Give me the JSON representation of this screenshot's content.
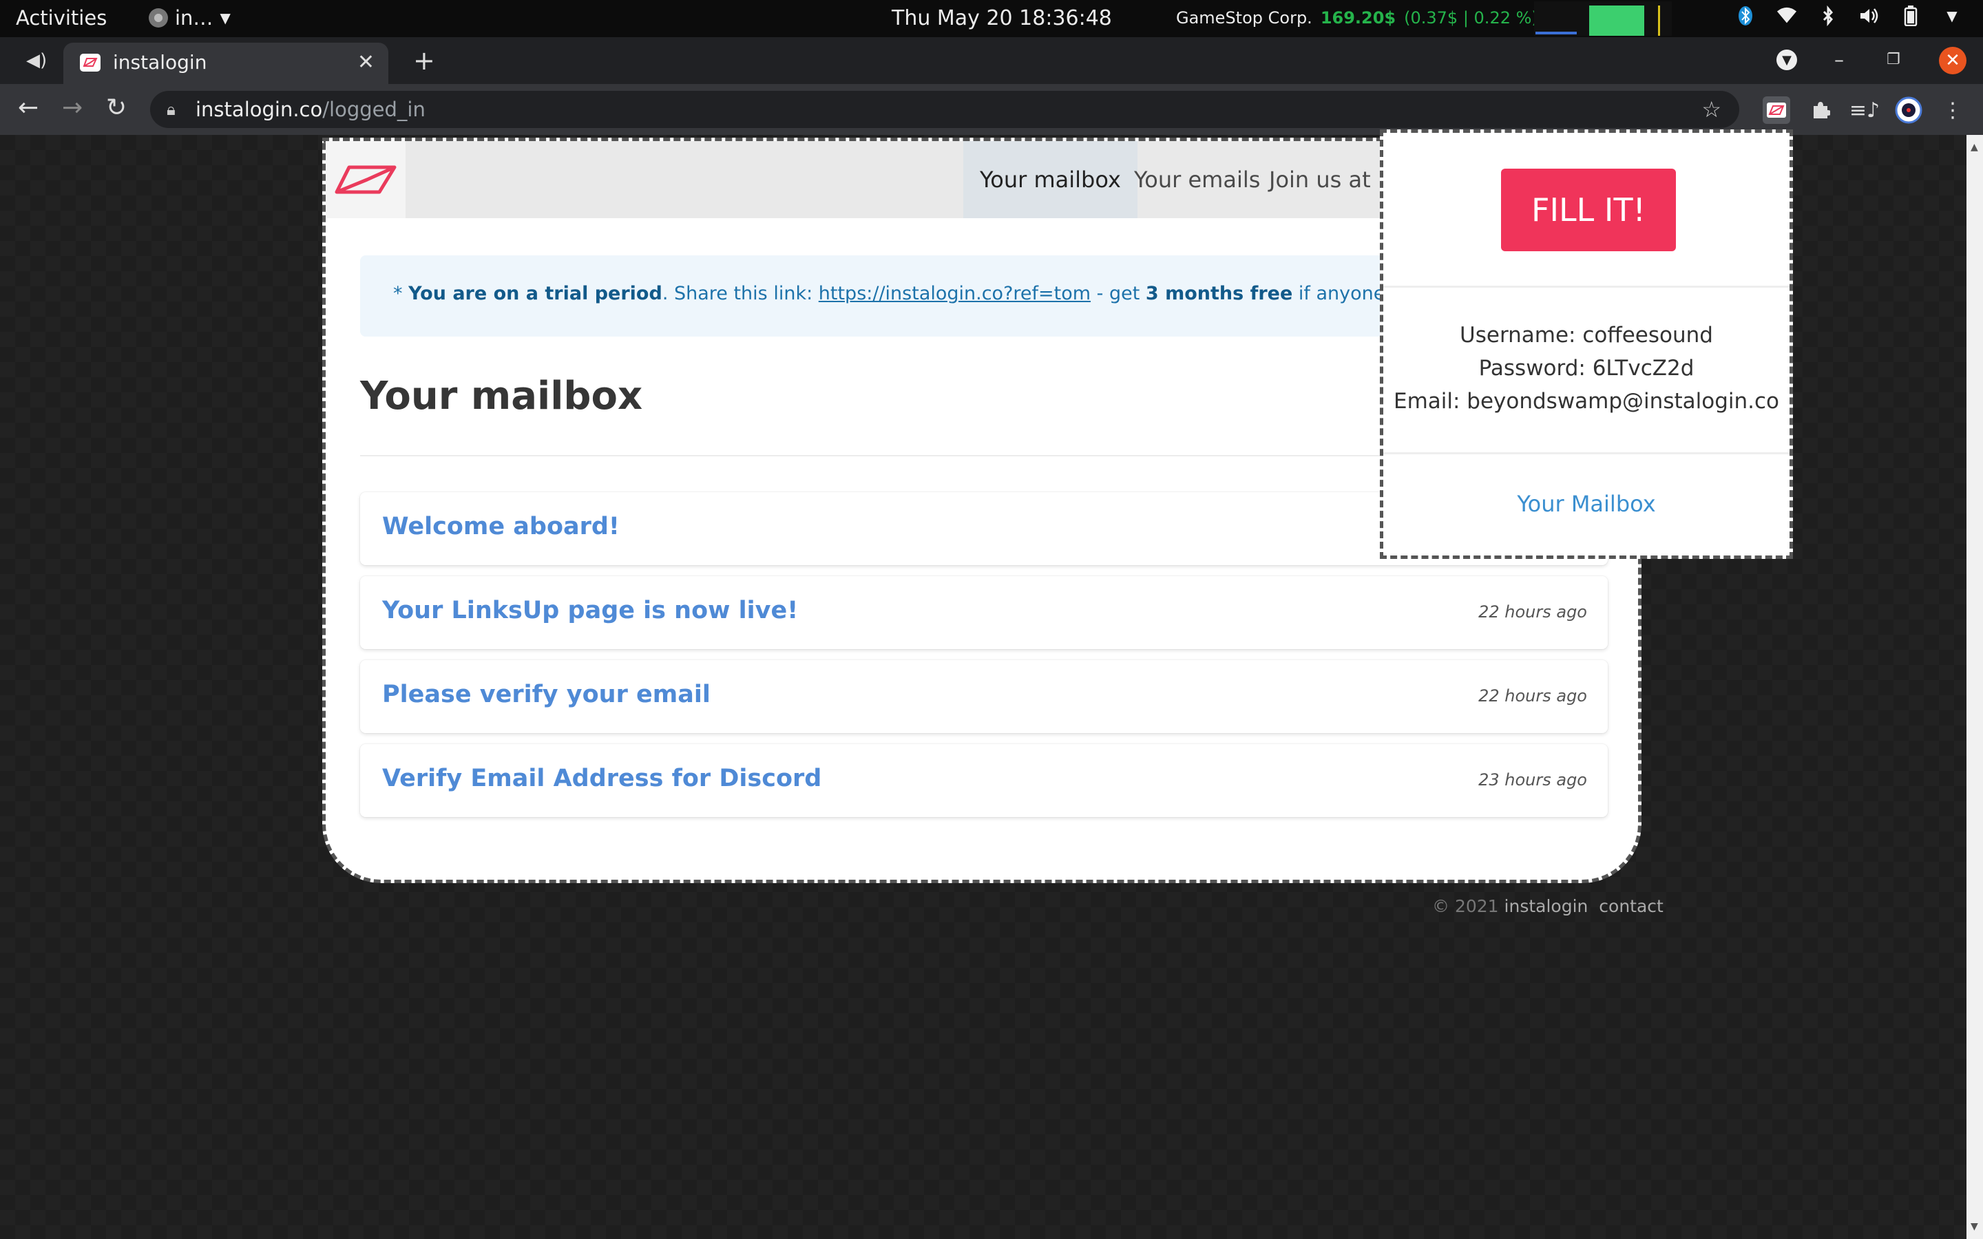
{
  "system": {
    "activities": "Activities",
    "app_menu": "in…",
    "clock": "Thu May 20  18:36:48",
    "stock_name": "GameStop Corp.",
    "stock_price": "169.20$",
    "stock_change": "(0.37$ | 0.22 %)"
  },
  "browser": {
    "tab_title": "instalogin",
    "url_domain": "instalogin.co",
    "url_path": "/logged_in"
  },
  "site": {
    "nav": [
      "Your mailbox",
      "Your emails",
      "Join us at"
    ],
    "notice": {
      "prefix": "* ",
      "trial": "You are on a trial period",
      "share": ". Share this link: ",
      "link": "https://instalogin.co?ref=tom",
      "get": " - get ",
      "free": "3 months free",
      "suffix": " if anyone buys a membe"
    },
    "heading": "Your mailbox",
    "emails": [
      {
        "subject": "Welcome aboard!",
        "when": ""
      },
      {
        "subject": "Your LinksUp page is now live!",
        "when": "22 hours ago"
      },
      {
        "subject": "Please verify your email",
        "when": "22 hours ago"
      },
      {
        "subject": "Verify Email Address for Discord",
        "when": "23 hours ago"
      }
    ],
    "footer": {
      "copy": "© 2021 ",
      "brand": "instalogin",
      "contact": "contact"
    }
  },
  "popup": {
    "fill_label": "FILL IT!",
    "username": "Username: coffeesound",
    "password": "Password: 6LTvcZ2d",
    "email": "Email: beyondswamp@instalogin.co",
    "mailbox_link": "Your Mailbox"
  },
  "colors": {
    "accent": "#f0345a",
    "link": "#4f8ad6",
    "notice_bg": "#eef6fc",
    "stock_up": "#25b34b"
  }
}
